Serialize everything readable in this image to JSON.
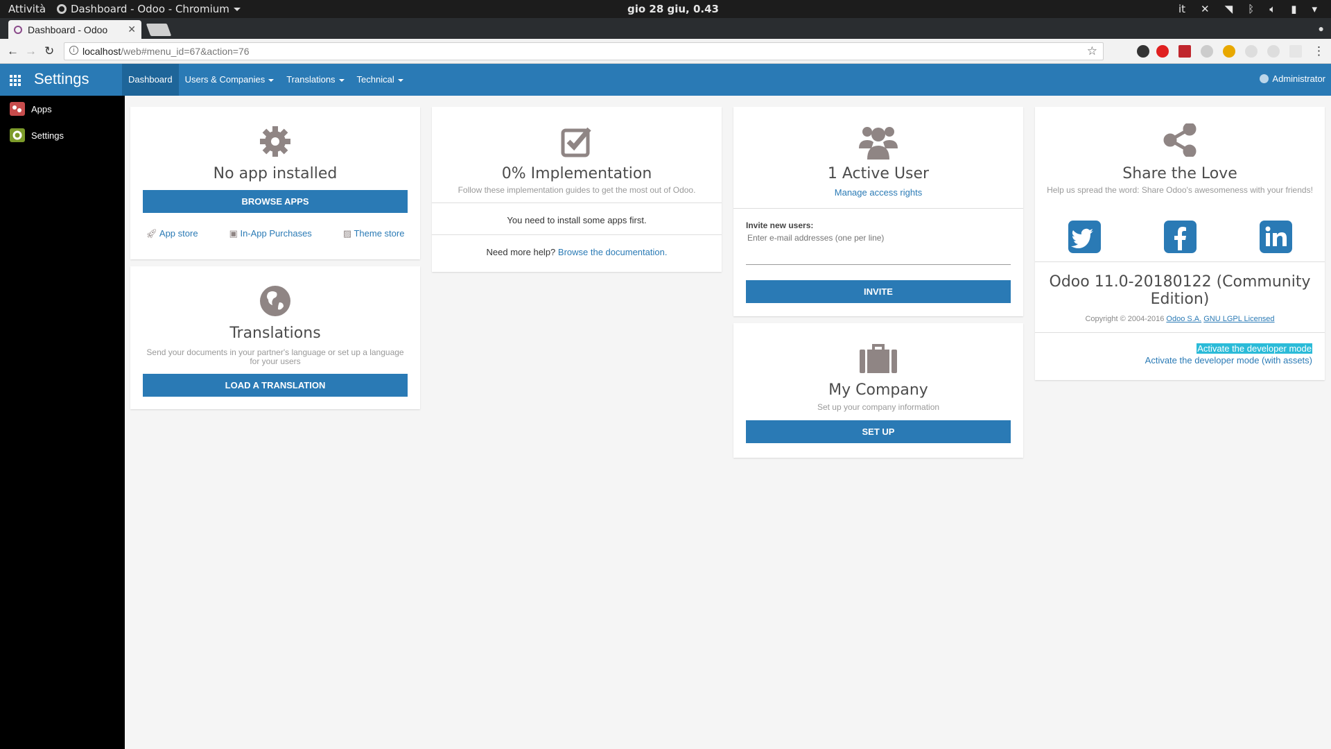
{
  "os_bar": {
    "activities": "Attività",
    "app_title": "Dashboard - Odoo - Chromium",
    "clock": "gio 28 giu,  0.43",
    "lang": "it"
  },
  "browser": {
    "tab_title": "Dashboard - Odoo",
    "url_host": "localhost",
    "url_path": "/web#menu_id=67&action=76"
  },
  "topnav": {
    "brand": "Settings",
    "menu": [
      {
        "label": "Dashboard",
        "active": true,
        "dropdown": false
      },
      {
        "label": "Users & Companies",
        "active": false,
        "dropdown": true
      },
      {
        "label": "Translations",
        "active": false,
        "dropdown": true
      },
      {
        "label": "Technical",
        "active": false,
        "dropdown": true
      }
    ],
    "user": "Administrator"
  },
  "sidebar": {
    "items": [
      {
        "label": "Apps"
      },
      {
        "label": "Settings"
      }
    ]
  },
  "apps_card": {
    "title": "No app installed",
    "button": "BROWSE APPS",
    "links": [
      "App store",
      "In-App Purchases",
      "Theme store"
    ]
  },
  "translations_card": {
    "title": "Translations",
    "subtitle": "Send your documents in your partner's language or set up a language for your users",
    "button": "LOAD A TRANSLATION"
  },
  "implementation_card": {
    "title": "0% Implementation",
    "subtitle": "Follow these implementation guides to get the most out of Odoo.",
    "notice": "You need to install some apps first.",
    "help_prefix": "Need more help?",
    "help_link": "Browse the documentation."
  },
  "users_card": {
    "title": "1 Active User",
    "link": "Manage access rights",
    "invite_label": "Invite new users:",
    "invite_placeholder": "Enter e-mail addresses (one per line)",
    "button": "INVITE"
  },
  "company_card": {
    "title": "My Company",
    "subtitle": "Set up your company information",
    "button": "SET UP"
  },
  "share_card": {
    "title": "Share the Love",
    "subtitle": "Help us spread the word: Share Odoo's awesomeness with your friends!",
    "version": "Odoo 11.0-20180122 (Community Edition)",
    "copyright": "Copyright © 2004-2016",
    "link_company": "Odoo S.A.",
    "link_license": "GNU LGPL Licensed",
    "dev_mode": "Activate the developer mode",
    "dev_mode_assets": "Activate the developer mode (with assets)"
  },
  "colors": {
    "primary": "#2a7ab5",
    "sidebar": "#000000",
    "background": "#f5f5f5",
    "icon_gray": "#8f8584"
  }
}
